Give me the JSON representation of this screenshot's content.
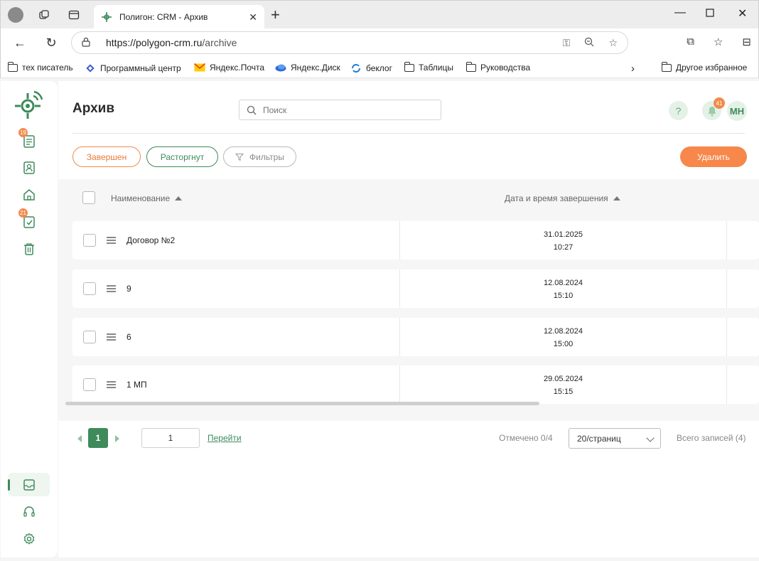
{
  "browser": {
    "tab_title": "Полигон: CRM - Архив",
    "url_host": "https://polygon-crm.ru",
    "url_path": "/archive",
    "bookmarks": [
      {
        "label": "тех писатель",
        "icon": "folder-icon"
      },
      {
        "label": "Программный центр",
        "icon": "diamond-grid-icon"
      },
      {
        "label": "Яндекс.Почта",
        "icon": "mail-icon"
      },
      {
        "label": "Яндекс.Диск",
        "icon": "cloud-icon"
      },
      {
        "label": "беклог",
        "icon": "sync-icon"
      },
      {
        "label": "Таблицы",
        "icon": "folder-icon"
      },
      {
        "label": "Руководства",
        "icon": "folder-icon"
      }
    ],
    "other_bookmarks": "Другое избранное"
  },
  "sidebar": {
    "items": [
      {
        "name": "documents",
        "badge": "19"
      },
      {
        "name": "contacts",
        "badge": ""
      },
      {
        "name": "home",
        "badge": ""
      },
      {
        "name": "tasks",
        "badge": "21"
      },
      {
        "name": "trash",
        "badge": ""
      }
    ]
  },
  "header": {
    "title": "Архив",
    "search_placeholder": "Поиск",
    "help_label": "?",
    "notifications_count": "41",
    "avatar_initials": "МН"
  },
  "filters": {
    "completed": "Завершен",
    "terminated": "Расторгнут",
    "filters": "Фильтры",
    "delete": "Удалить"
  },
  "table": {
    "col_name": "Наименование",
    "col_date": "Дата и время завершения",
    "rows": [
      {
        "name": "Договор №2",
        "date": "31.01.2025",
        "time": "10:27"
      },
      {
        "name": "9",
        "date": "12.08.2024",
        "time": "15:10"
      },
      {
        "name": "6",
        "date": "12.08.2024",
        "time": "15:00"
      },
      {
        "name": "1 МП",
        "date": "29.05.2024",
        "time": "15:15"
      }
    ]
  },
  "pagination": {
    "current_page": "1",
    "goto_value": "1",
    "goto_label": "Перейти",
    "selected": "Отмечено 0/4",
    "per_page": "20/страниц",
    "total": "Всего записей (4)"
  },
  "colors": {
    "accent_green": "#3e8a5b",
    "accent_orange": "#f7874a"
  }
}
